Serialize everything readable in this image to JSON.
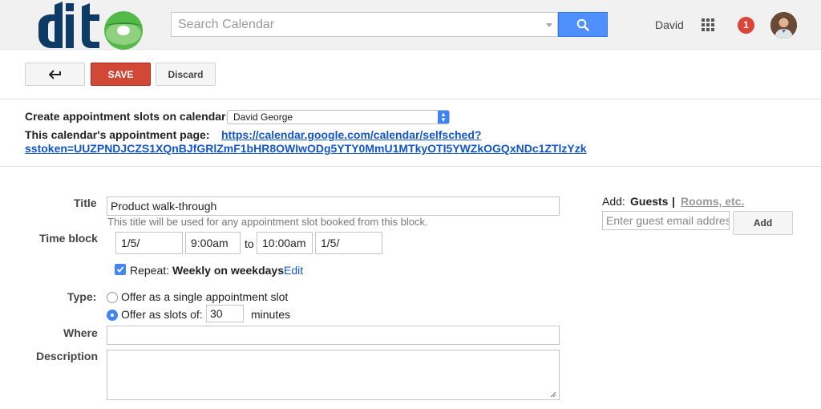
{
  "header": {
    "logo_text": "dito",
    "search_placeholder": "Search Calendar",
    "user_name": "David",
    "notification_count": "1",
    "accent_color": "#4d90fe",
    "icons": [
      "search-icon",
      "apps-grid-icon",
      "avatar"
    ]
  },
  "toolbar": {
    "back_label": "",
    "save_label": "SAVE",
    "discard_label": "Discard",
    "icons": [
      "back-arrow-icon"
    ]
  },
  "calendar": {
    "create_label": "Create appointment slots on calendar:",
    "selected_calendar": "David George",
    "page_label": "This calendar's appointment page:",
    "page_url_line1": "https://calendar.google.com/calendar/selfsched?",
    "page_url_line2": "sstoken=UUZPNDJCZS1XQnBJfGRlZmF1bHR8OWIwODg5YTY0MmU1MTkyOTI5YWZkOGQxNDc1ZTlzYzk"
  },
  "form": {
    "title_label": "Title",
    "title_value": "Product walk-through",
    "title_hint": "This title will be used for any appointment slot booked from this block.",
    "time_block_label": "Time block",
    "start_date": "1/5/",
    "start_time": "9:00am",
    "to_text": "to",
    "end_time": "10:00am",
    "end_date": "1/5/",
    "repeat_checked": true,
    "repeat_prefix": "Repeat:",
    "repeat_value": "Weekly on weekdays",
    "repeat_edit": "Edit",
    "type_label": "Type:",
    "type_option_single": "Offer as a single appointment slot",
    "type_option_slots": "Offer as slots of:",
    "slot_minutes": "30",
    "minutes_label": "minutes",
    "selected_type": "slots",
    "where_label": "Where",
    "where_value": "",
    "description_label": "Description",
    "description_value": ""
  },
  "guests": {
    "add_label": "Add:",
    "guests_tab": "Guests",
    "separator": "|",
    "rooms_tab": "Rooms, etc.",
    "guest_placeholder": "Enter guest email addres",
    "add_button": "Add"
  }
}
